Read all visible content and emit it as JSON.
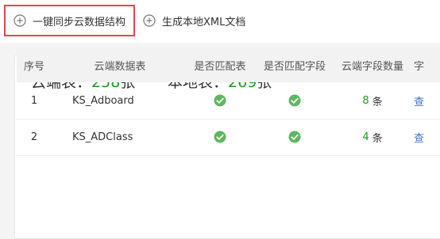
{
  "toolbar": {
    "sync_label": "一键同步云数据结构",
    "xml_label": "生成本地XML文档"
  },
  "stats": {
    "remote_label": "云端表：",
    "remote_count": "258",
    "remote_unit": "张",
    "local_label": "本地表：",
    "local_count": "269",
    "local_unit": "张"
  },
  "table": {
    "columns": [
      "序号",
      "云端数据表",
      "是否匹配表",
      "是否匹配字段",
      "云端字段数量",
      "字"
    ],
    "rows": [
      {
        "seq": "1",
        "name": "KS_Adboard",
        "field_count": "8",
        "unit": "条",
        "action": "查"
      },
      {
        "seq": "2",
        "name": "KS_ADClass",
        "field_count": "4",
        "unit": "条",
        "action": "查"
      }
    ]
  },
  "colors": {
    "accent_green": "#1a9a1a",
    "check_green": "#5cb85c",
    "active_border": "#e2464c",
    "link_blue": "#3a74c7"
  },
  "icons": [
    "plus-circle-icon",
    "check-circle-icon"
  ]
}
